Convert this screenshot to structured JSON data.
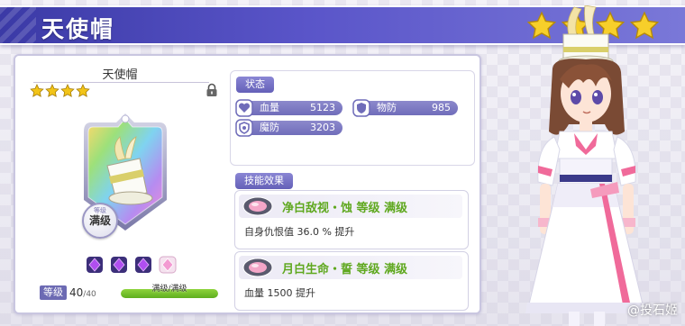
{
  "header": {
    "title": "天使帽",
    "rarity_stars": 4
  },
  "equipment": {
    "name": "天使帽",
    "stars": 4,
    "rank_badge_top": "等级",
    "rank_badge": "满级",
    "level_label": "等级",
    "level_current": "40",
    "level_max": "/40",
    "level_bar_text": "满级/满级",
    "level_progress": 1.0,
    "gems": [
      "purple-gem",
      "purple-gem",
      "purple-gem",
      "pink-gem"
    ]
  },
  "status": {
    "label": "状态",
    "stats": [
      {
        "icon": "heart-icon",
        "name": "血量",
        "value": "5123"
      },
      {
        "icon": "shield-icon",
        "name": "物防",
        "value": "985"
      },
      {
        "icon": "magic-shield-icon",
        "name": "魔防",
        "value": "3203"
      }
    ]
  },
  "skills": {
    "label": "技能效果",
    "items": [
      {
        "title": "净白敌视・蚀  等级 满级",
        "desc": "自身仇恨值 36.0 % 提升"
      },
      {
        "title": "月白生命・誓  等级 满级",
        "desc": "血量 1500 提升"
      }
    ]
  },
  "watermark": "@投石姬",
  "colors": {
    "banner": "#4b48b8",
    "accent": "#6c6ab3",
    "skill_green": "#5fa81f",
    "star": "#f2c418"
  }
}
